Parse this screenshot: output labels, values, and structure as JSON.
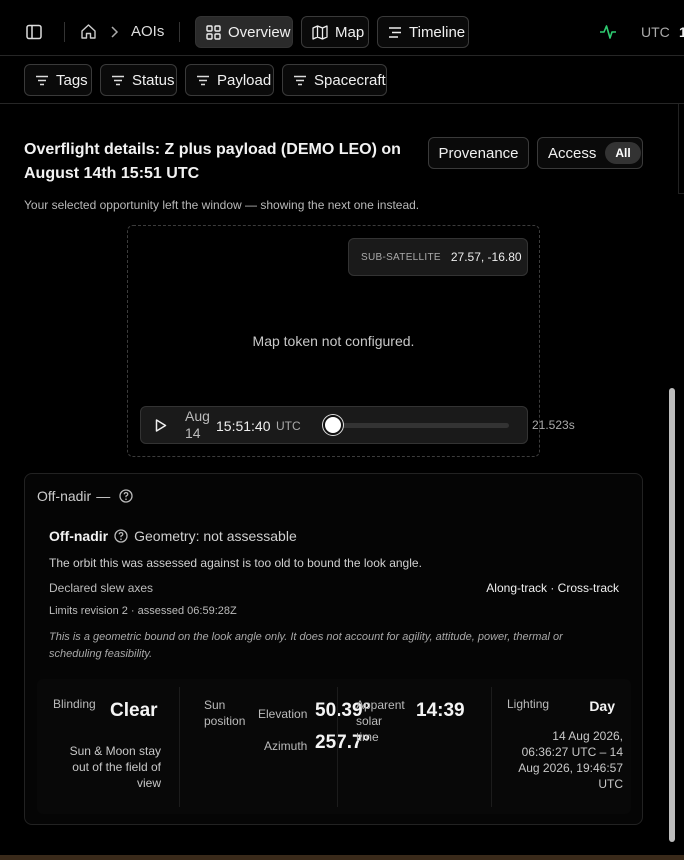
{
  "header": {
    "breadcrumb": "AOIs",
    "tabs": [
      {
        "label": "Overview"
      },
      {
        "label": "Map"
      },
      {
        "label": "Timeline"
      }
    ],
    "utc_label": "UTC",
    "utc_value_partial": "1"
  },
  "filters": [
    {
      "label": "Tags"
    },
    {
      "label": "Status"
    },
    {
      "label": "Payload"
    },
    {
      "label": "Spacecraft"
    }
  ],
  "overflight": {
    "title_line1": "Overflight details: Z plus payload (DEMO LEO) on",
    "title_line2": "August 14th 15:51 UTC",
    "notice": "Your selected opportunity left the window — showing the next one instead.",
    "provenance_label": "Provenance",
    "access_label": "Access",
    "access_badge": "All"
  },
  "map": {
    "subsat_label": "SUB-SATELLITE",
    "subsat_value": "27.57, -16.80",
    "token_message": "Map token not configured.",
    "player": {
      "date_month": "Aug",
      "date_day": "14",
      "time": "15:51:40",
      "tz": "UTC",
      "duration": "21.523s",
      "progress": 0.0
    }
  },
  "offnadir": {
    "section_title": "Off-nadir",
    "section_dash": "—",
    "heading": "Off-nadir",
    "geometry": "Geometry: not assessable",
    "description": "The orbit this was assessed against is too old to bound the look angle.",
    "slew_label": "Declared slew axes",
    "slew_value": "Along-track · Cross-track",
    "limits": "Limits revision 2 · assessed 06:59:28Z",
    "disclaimer_line1": "This is a geometric bound on the look angle only. It does not account for agility, attitude, power, thermal or",
    "disclaimer_line2": "scheduling feasibility."
  },
  "metrics": {
    "blinding_label": "Blinding",
    "blinding_value": "Clear",
    "blinding_note_1": "Sun & Moon stay",
    "blinding_note_2": "out of the field of",
    "blinding_note_3": "view",
    "sun_label_1": "Sun",
    "sun_label_2": "position",
    "elevation_label": "Elevation",
    "elevation_value": "50.39°",
    "azimuth_label": "Azimuth",
    "azimuth_value": "257.7°",
    "solar_label_1": "Apparent",
    "solar_label_2": "solar",
    "solar_label_3": "time",
    "solar_value": "14:39",
    "lighting_label": "Lighting",
    "lighting_value": "Day",
    "lighting_range_1": "14 Aug 2026,",
    "lighting_range_2": "06:36:27 UTC – 14",
    "lighting_range_3": "Aug 2026, 19:46:57",
    "lighting_range_4": "UTC"
  }
}
